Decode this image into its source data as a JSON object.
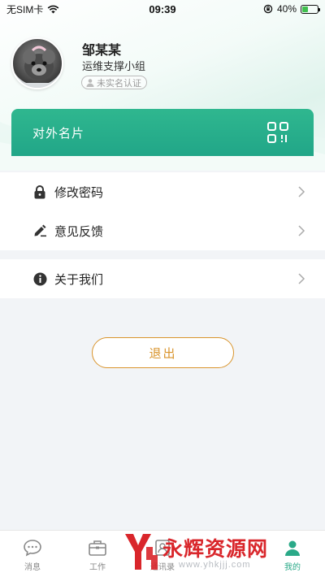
{
  "status_bar": {
    "carrier": "无SIM卡",
    "time": "09:39",
    "battery": "40%",
    "battery_level": 0.4
  },
  "profile": {
    "name": "邹某某",
    "group": "运维支撑小组",
    "auth_status": "未实名认证"
  },
  "card_banner": {
    "label": "对外名片",
    "icon": "qrcode-icon"
  },
  "menu_group_1": [
    {
      "label": "修改密码",
      "icon": "lock-icon"
    },
    {
      "label": "意见反馈",
      "icon": "pen-feedback-icon"
    }
  ],
  "menu_group_2": [
    {
      "label": "关于我们",
      "icon": "info-icon"
    }
  ],
  "logout_label": "退出",
  "tabbar": {
    "tabs": [
      {
        "label": "消息",
        "icon": "chat-icon"
      },
      {
        "label": "工作",
        "icon": "briefcase-icon"
      },
      {
        "label": "通讯录",
        "icon": "contacts-icon"
      },
      {
        "label": "",
        "icon": "tab-icon"
      },
      {
        "label": "我的",
        "icon": "person-icon"
      }
    ]
  },
  "watermark": {
    "text": "永辉资源网",
    "url": "www.yhkjjj.com"
  },
  "colors": {
    "accent": "#2aa988",
    "banner": "#21a688",
    "logout": "#d9942c",
    "watermark": "#d9262b"
  }
}
